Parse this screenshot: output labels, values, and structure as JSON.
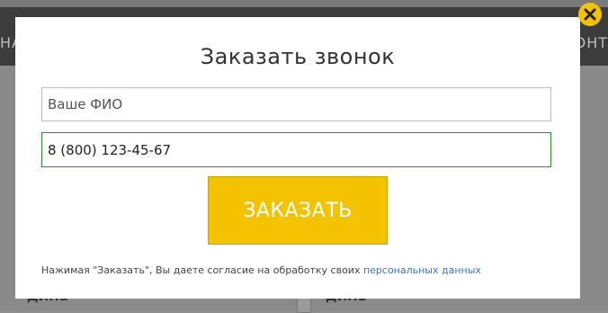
{
  "background": {
    "nav_left_text": "НА",
    "nav_right_text": "ОНТ",
    "content_left_text": "ДИНЬ",
    "content_right_text": "ДИНЬ"
  },
  "modal": {
    "title": "Заказать звонок",
    "name_field": {
      "placeholder": "Ваше ФИО",
      "value": ""
    },
    "phone_field": {
      "value": "8 (800) 123-45-67"
    },
    "submit_label": "ЗАКАЗАТЬ",
    "consent_text": "Нажимая \"Заказать\", Вы даете согласие на обработку своих ",
    "consent_link": "персональных данных",
    "close_icon": "close-icon"
  },
  "colors": {
    "accent": "#f3c300",
    "link": "#3a78b5",
    "focus_border": "#2e8b2e"
  }
}
